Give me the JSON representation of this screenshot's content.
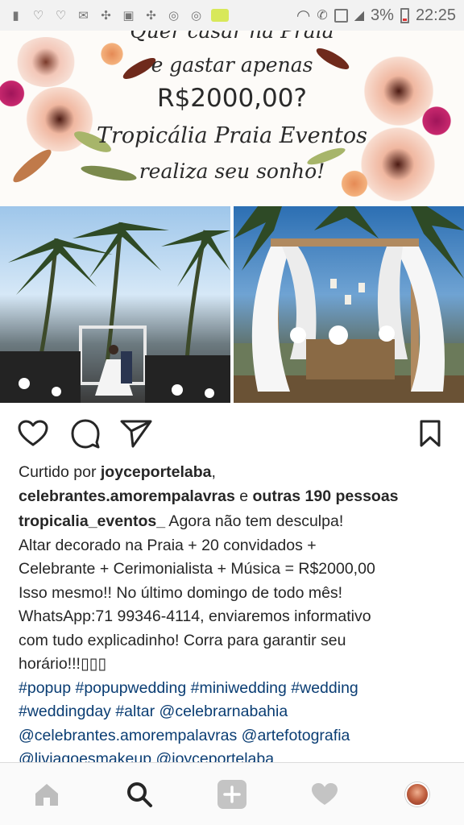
{
  "status_bar": {
    "battery": "3%",
    "time": "22:25",
    "icons": [
      "notification-icon",
      "heart-outline-icon",
      "heart-outline-icon",
      "mail-icon",
      "puzzle-icon",
      "image-icon",
      "puzzle-icon",
      "instagram-icon",
      "instagram-icon",
      "whatsapp-icon"
    ]
  },
  "banner": {
    "line1": "Quer casar na Praia",
    "line2": "e gastar apenas",
    "line3": "R$2000,00?",
    "line4": "Tropicália Praia Eventos",
    "line5": "realiza seu sonho!"
  },
  "post": {
    "liked_by_prefix": "Curtido por ",
    "liked_user1": "joyceportelaba",
    "liked_sep": ",",
    "liked_user2": "celebrantes.amorempalavras",
    "liked_and": " e ",
    "liked_others": "outras 190 pessoas",
    "author": "tropicalia_eventos_",
    "caption_lines": [
      " Agora não tem desculpa!",
      "Altar decorado na Praia + 20 convidados +",
      "Celebrante + Cerimonialista + Música = R$2000,00",
      "Isso mesmo!! No último domingo de todo mês!",
      "WhatsApp:71 99346-4114, enviaremos informativo",
      "com tudo explicadinho! Corra para garantir seu",
      "horário!!!▯▯▯"
    ],
    "hashtag_lines": [
      "#popup #popupwedding #miniwedding #wedding",
      "#weddingday #altar @celebrarnabahia",
      "@celebrantes.amorempalavras @artefotografia",
      "@liviagoesmakeup @joyceportelaba"
    ]
  },
  "colors": {
    "hashtag": "#0a3d73",
    "text": "#262626",
    "nav_bg": "#fafafa"
  }
}
